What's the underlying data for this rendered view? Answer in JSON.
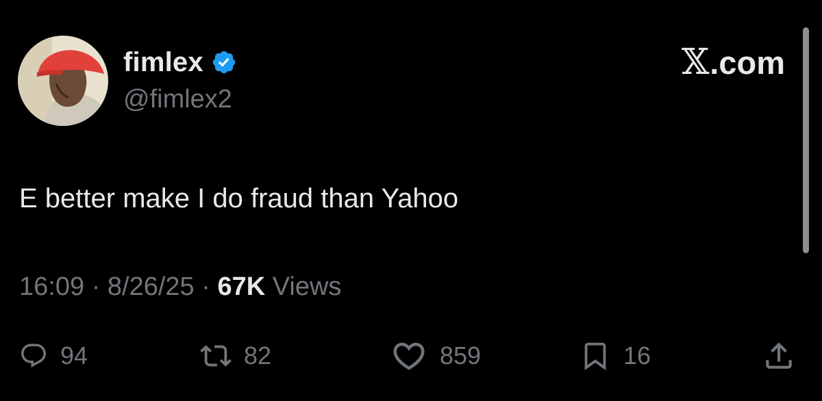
{
  "author": {
    "display_name": "fimlex",
    "handle": "@fimlex2",
    "verified_icon": "verified-badge-icon"
  },
  "brand": {
    "x_glyph": "𝕏",
    "domain": ".com"
  },
  "tweet": {
    "text": "E better make I do fraud than Yahoo"
  },
  "meta": {
    "time": "16:09",
    "sep1": " · ",
    "date": "8/26/25",
    "sep2": " · ",
    "views_count": "67K",
    "views_label": " Views"
  },
  "actions": {
    "reply": {
      "icon": "reply-icon",
      "count": "94"
    },
    "repost": {
      "icon": "repost-icon",
      "count": "82"
    },
    "like": {
      "icon": "heart-icon",
      "count": "859"
    },
    "bookmark": {
      "icon": "bookmark-icon",
      "count": "16"
    },
    "share": {
      "icon": "share-icon"
    }
  },
  "colors": {
    "background": "#000000",
    "primary_text": "#e7e9ea",
    "secondary_text": "#71767b",
    "verified_blue": "#1d9bf0"
  }
}
